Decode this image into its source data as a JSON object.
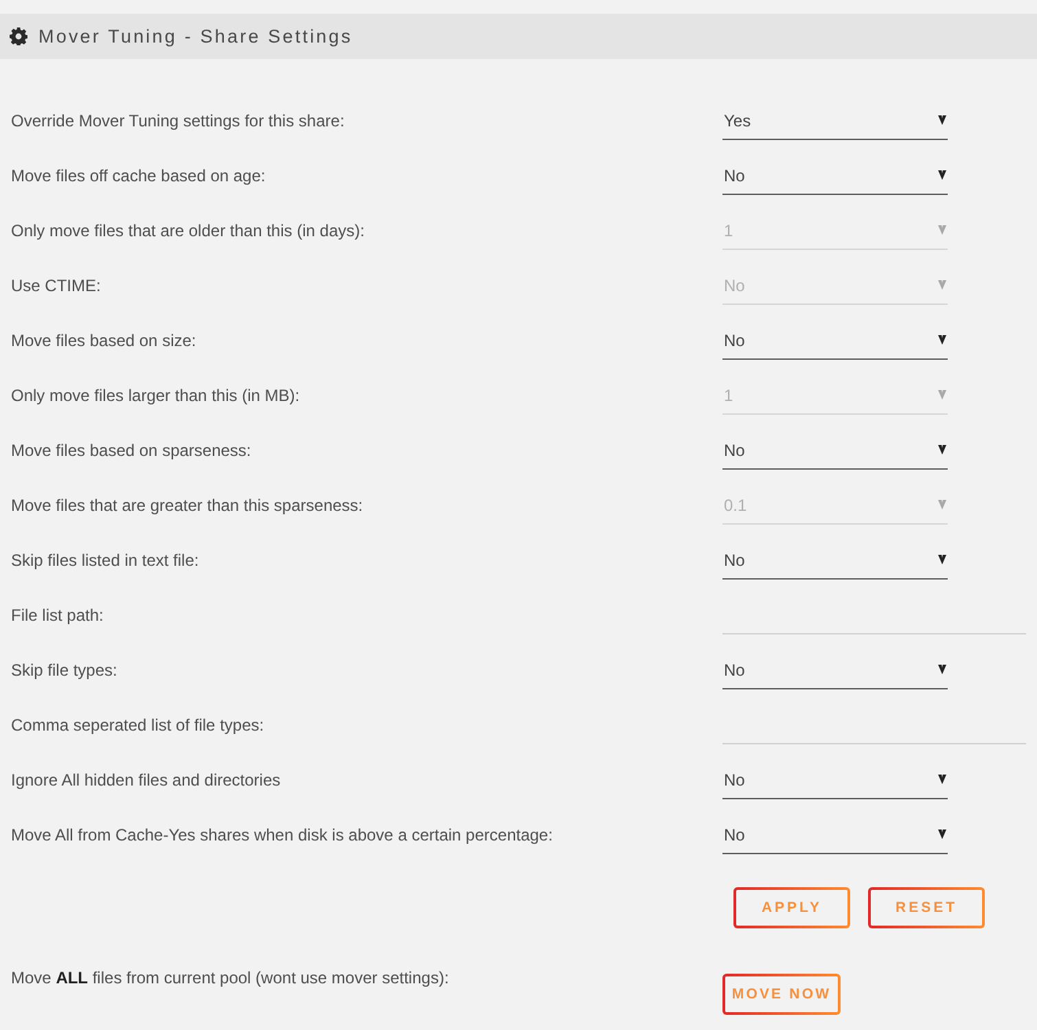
{
  "panel": {
    "title": "Mover Tuning - Share Settings"
  },
  "settings": [
    {
      "label": "Override Mover Tuning settings for this share:",
      "kind": "select",
      "value": "Yes",
      "disabled": false
    },
    {
      "label": "Move files off cache based on age:",
      "kind": "select",
      "value": "No",
      "disabled": false
    },
    {
      "label": "Only move files that are older than this (in days):",
      "kind": "select",
      "value": "1",
      "disabled": true
    },
    {
      "label": "Use CTIME:",
      "kind": "select",
      "value": "No",
      "disabled": true
    },
    {
      "label": "Move files based on size:",
      "kind": "select",
      "value": "No",
      "disabled": false
    },
    {
      "label": "Only move files larger than this (in MB):",
      "kind": "select",
      "value": "1",
      "disabled": true
    },
    {
      "label": "Move files based on sparseness:",
      "kind": "select",
      "value": "No",
      "disabled": false
    },
    {
      "label": "Move files that are greater than this sparseness:",
      "kind": "select",
      "value": "0.1",
      "disabled": true
    },
    {
      "label": "Skip files listed in text file:",
      "kind": "select",
      "value": "No",
      "disabled": false
    },
    {
      "label": "File list path:",
      "kind": "text",
      "disabled": true
    },
    {
      "label": "Skip file types:",
      "kind": "select",
      "value": "No",
      "disabled": false
    },
    {
      "label": "Comma seperated list of file types:",
      "kind": "text",
      "disabled": true
    },
    {
      "label": "Ignore All hidden files and directories",
      "kind": "select",
      "value": "No",
      "disabled": false
    },
    {
      "label": "Move All from Cache-Yes shares when disk is above a certain percentage:",
      "kind": "select",
      "value": "No",
      "disabled": false
    }
  ],
  "actions": [
    {
      "label": "APPLY"
    },
    {
      "label": "RESET"
    }
  ],
  "move_all": {
    "label": "Move **ALL** files from current pool (wont use mover settings):",
    "button": "MOVE NOW"
  }
}
